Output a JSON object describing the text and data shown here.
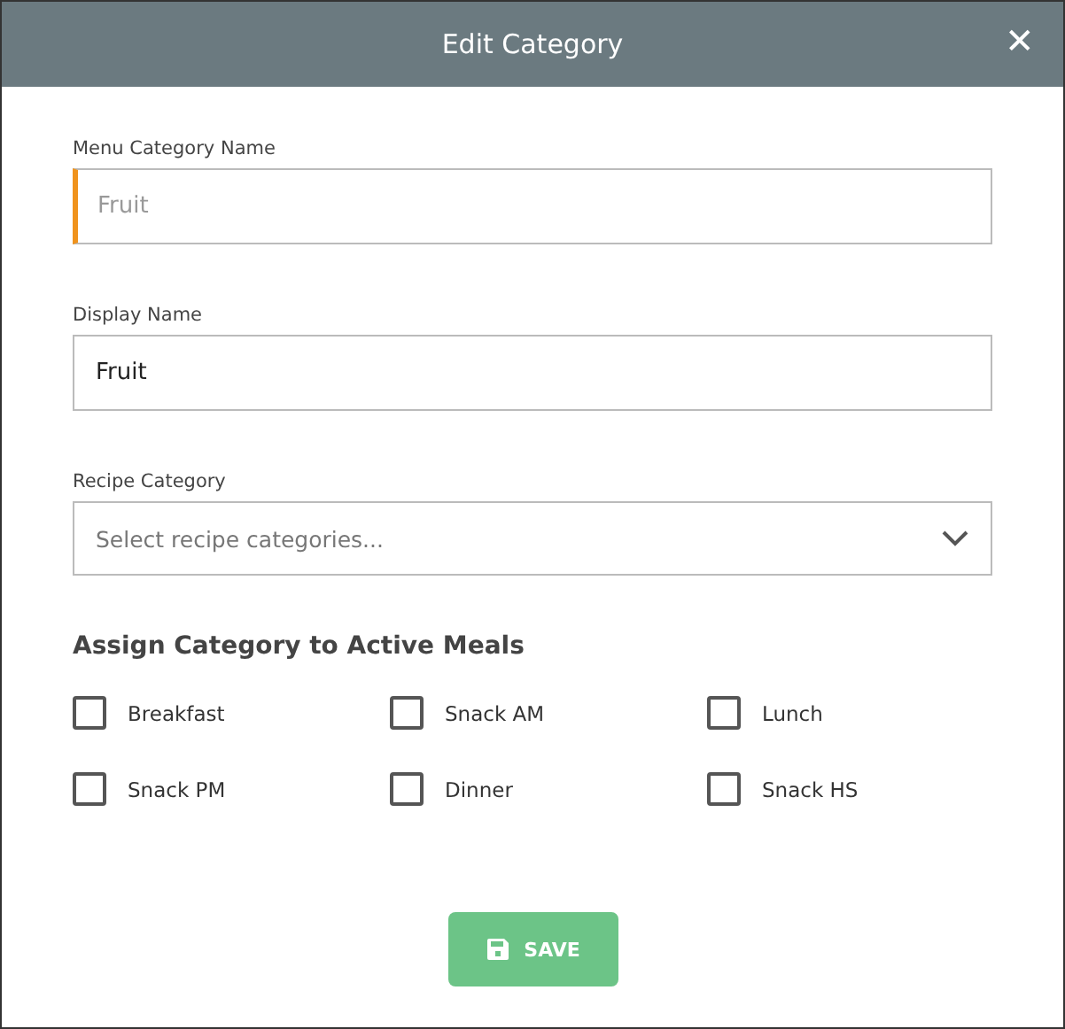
{
  "dialog": {
    "title": "Edit Category",
    "close": "✕"
  },
  "fields": [
    {
      "kind": "text",
      "label": "Menu Category Name",
      "value": "Fruit",
      "disabled": true
    },
    {
      "kind": "text",
      "label": "Display Name",
      "value": "Fruit",
      "disabled": false
    },
    {
      "kind": "select",
      "label": "Recipe Category",
      "placeholder": "Select recipe categories...",
      "disabled": false
    }
  ],
  "meals": {
    "heading": "Assign Category to Active Meals",
    "options": [
      {
        "label": "Breakfast",
        "checked": false
      },
      {
        "label": "Snack AM",
        "checked": false
      },
      {
        "label": "Lunch",
        "checked": false
      },
      {
        "label": "Snack PM",
        "checked": false
      },
      {
        "label": "Dinner",
        "checked": false
      },
      {
        "label": "Snack HS",
        "checked": false
      }
    ]
  },
  "save_button": {
    "label": "SAVE"
  }
}
